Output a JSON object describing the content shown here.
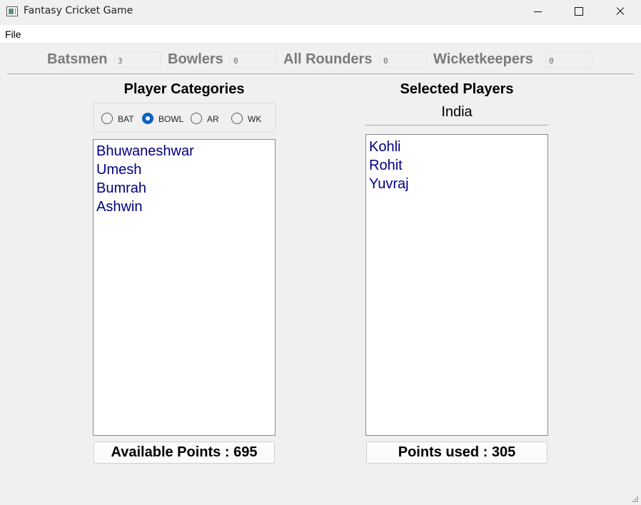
{
  "window": {
    "title": "Fantasy Cricket Game"
  },
  "menu": {
    "file": "File"
  },
  "counters": [
    {
      "label": "Batsmen",
      "value": "3"
    },
    {
      "label": "Bowlers",
      "value": "0"
    },
    {
      "label": "All Rounders",
      "value": "0"
    },
    {
      "label": "Wicketkeepers",
      "value": "0"
    }
  ],
  "left_panel": {
    "heading": "Player Categories",
    "radios": [
      {
        "label": "BAT",
        "checked": false
      },
      {
        "label": "BOWL",
        "checked": true
      },
      {
        "label": "AR",
        "checked": false
      },
      {
        "label": "WK",
        "checked": false
      }
    ],
    "players": [
      "Bhuwaneshwar",
      "Umesh",
      "Bumrah",
      "Ashwin"
    ],
    "points": "Available Points : 695"
  },
  "right_panel": {
    "heading": "Selected Players",
    "team": "India",
    "players": [
      "Kohli",
      "Rohit",
      "Yuvraj"
    ],
    "points": "Points used : 305"
  },
  "colors": {
    "accent": "#0b62c4",
    "list_text": "#000080",
    "counter_label": "#7a7a7a"
  }
}
